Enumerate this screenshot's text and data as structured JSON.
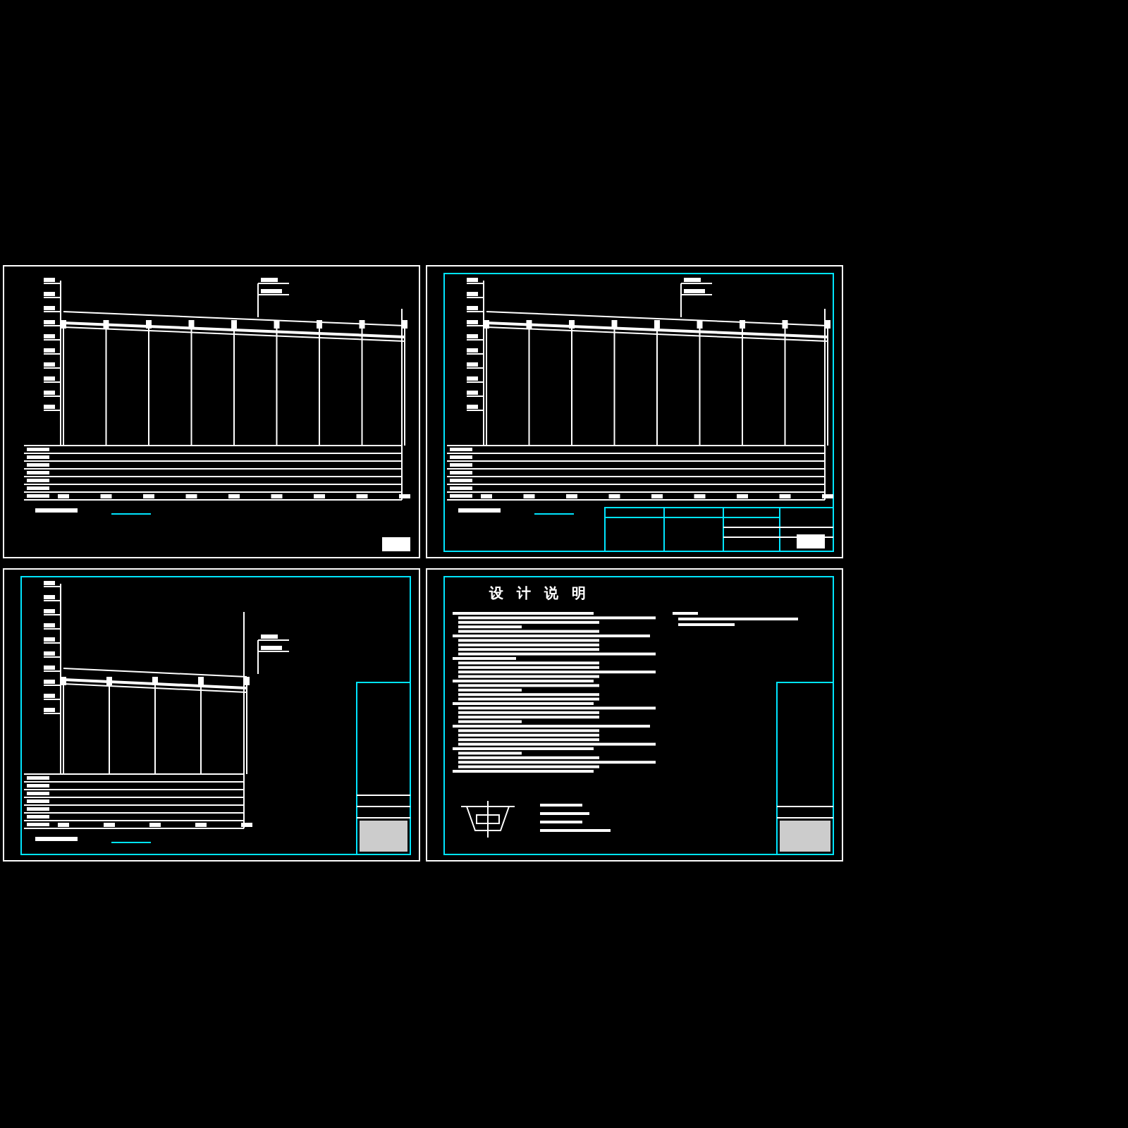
{
  "sheets": [
    {
      "kind": "profile",
      "frame": false
    },
    {
      "kind": "profile",
      "frame": true
    },
    {
      "kind": "profile_short",
      "frame": true
    },
    {
      "kind": "notes",
      "frame": true,
      "title": "设 计 说 明"
    }
  ]
}
